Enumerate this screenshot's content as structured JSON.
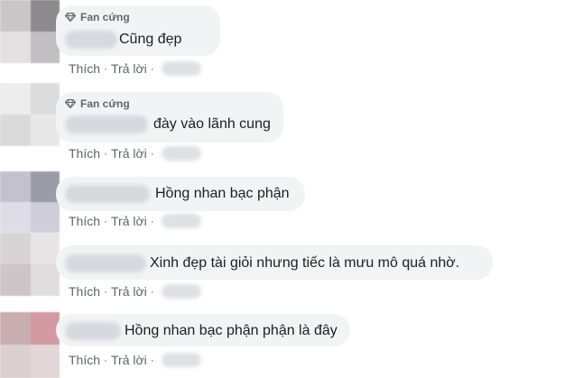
{
  "labels": {
    "badge": "Fan cứng",
    "like": "Thích",
    "separator": "·",
    "reply": "Trả lời"
  },
  "comments": [
    {
      "text": "Cũng đẹp",
      "has_badge": true
    },
    {
      "text": "đày vào lãnh cung",
      "has_badge": true
    },
    {
      "text": "Hồng nhan bạc phận",
      "has_badge": false
    },
    {
      "text": "Xinh đẹp tài giỏi nhưng tiếc là mưu mô quá nhờ.",
      "has_badge": false
    },
    {
      "text": "Hồng nhan bạc phận phận là đây",
      "has_badge": false
    }
  ],
  "icons": {
    "badge_icon": "diamond-icon"
  },
  "colors": {
    "bubble_bg": "#f2f3f5",
    "text": "#1c1e21",
    "meta_text": "#65676b",
    "action_text": "#5f6368"
  }
}
